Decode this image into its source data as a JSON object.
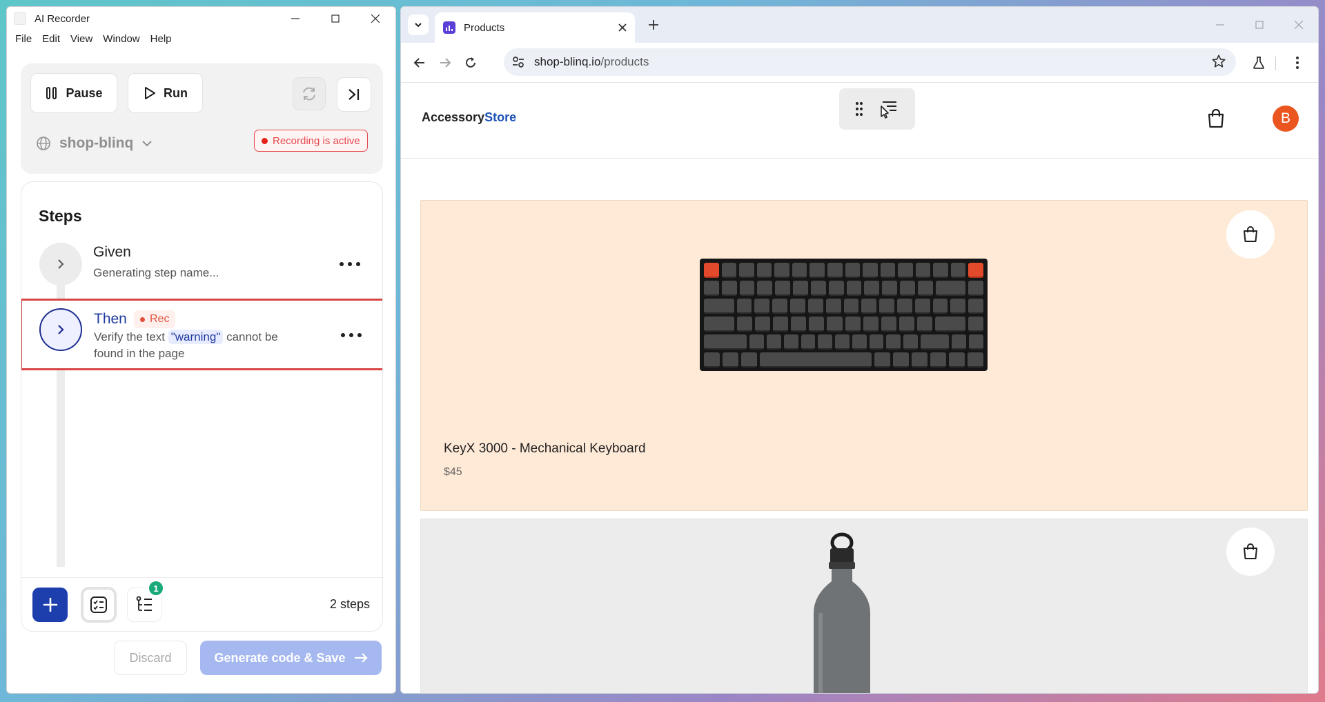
{
  "recorder": {
    "title": "AI Recorder",
    "menu": [
      "File",
      "Edit",
      "View",
      "Window",
      "Help"
    ],
    "controls": {
      "pause_label": "Pause",
      "run_label": "Run",
      "environment": "shop-blinq",
      "recording_status": "Recording is active"
    },
    "steps": {
      "heading": "Steps",
      "items": [
        {
          "keyword": "Given",
          "description": "Generating step name..."
        },
        {
          "keyword": "Then",
          "tag": "Rec",
          "desc_before": "Verify the text ",
          "desc_chip": "\"warning\"",
          "desc_after": " cannot be found in the page"
        }
      ],
      "badge_count": "1",
      "count_label": "2 steps"
    },
    "footer": {
      "discard_label": "Discard",
      "generate_label": "Generate code & Save"
    },
    "colors": {
      "primary": "#1d3fae",
      "recording": "#e5484d",
      "success": "#1aa97a"
    }
  },
  "browser": {
    "tab_title": "Products",
    "url_host": "shop-blinq.io",
    "url_path": "/products",
    "site": {
      "logo_part1": "Accessory",
      "logo_part2": "Store",
      "avatar_initial": "B",
      "accent_color": "#1d53b6"
    },
    "products": [
      {
        "name": "KeyX 3000 - Mechanical Keyboard",
        "price": "$45",
        "image": "keyboard"
      },
      {
        "image": "water-bottle"
      }
    ]
  }
}
